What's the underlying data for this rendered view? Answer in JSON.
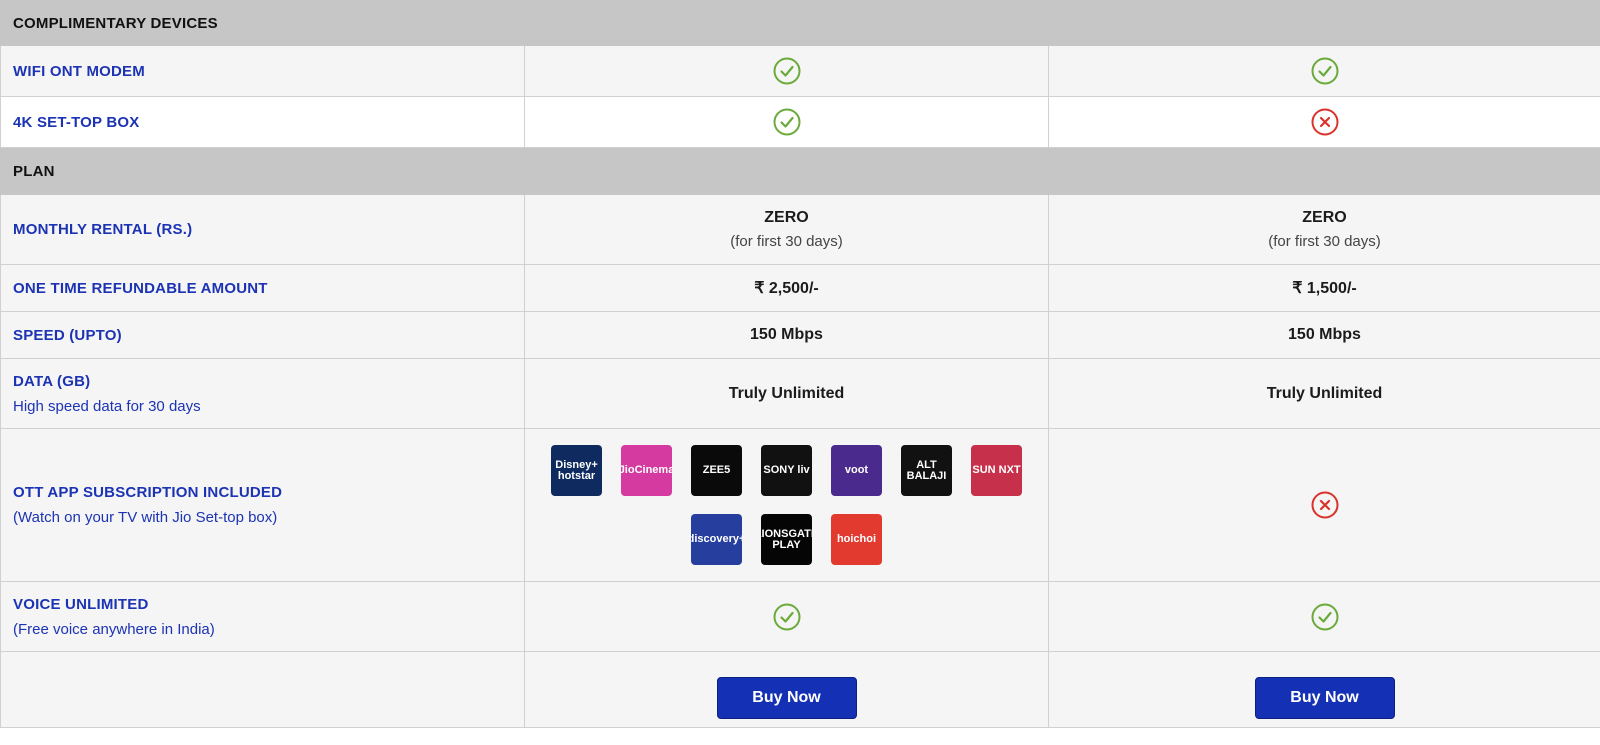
{
  "sections": {
    "devices": "COMPLIMENTARY DEVICES",
    "plan": "PLAN"
  },
  "rows": {
    "wifi": {
      "label": "WIFI ONT MODEM",
      "col1": "check",
      "col2": "check"
    },
    "stb": {
      "label": "4K SET-TOP BOX",
      "col1": "check",
      "col2": "cross"
    },
    "rental": {
      "label": "MONTHLY RENTAL (RS.)",
      "col1_main": "ZERO",
      "col1_sub": "(for first 30 days)",
      "col2_main": "ZERO",
      "col2_sub": "(for first 30 days)"
    },
    "refund": {
      "label": "ONE TIME REFUNDABLE AMOUNT",
      "col1": "₹ 2,500/-",
      "col2": "₹ 1,500/-"
    },
    "speed": {
      "label": "SPEED (UPTO)",
      "col1": "150 Mbps",
      "col2": "150 Mbps"
    },
    "data": {
      "label": "DATA (GB)",
      "sub": "High speed data for 30 days",
      "col1": "Truly Unlimited",
      "col2": "Truly Unlimited"
    },
    "ott": {
      "label": "OTT APP SUBSCRIPTION INCLUDED",
      "sub": "(Watch on your TV with Jio Set-top box)",
      "apps": [
        {
          "name": "disney-hotstar-logo",
          "text": "Disney+ hotstar",
          "color": "#0e2a5e"
        },
        {
          "name": "jiocinema-logo",
          "text": "JioCinema",
          "color": "#d43a9f"
        },
        {
          "name": "zee5-logo",
          "text": "ZEE5",
          "color": "#0a0a0a"
        },
        {
          "name": "sony-liv-logo",
          "text": "SONY liv",
          "color": "#111111"
        },
        {
          "name": "voot-logo",
          "text": "voot",
          "color": "#4a2a8c"
        },
        {
          "name": "alt-balaji-logo",
          "text": "ALT BALAJI",
          "color": "#111111"
        },
        {
          "name": "sun-nxt-logo",
          "text": "SUN NXT",
          "color": "#c7304a"
        },
        {
          "name": "discovery-plus-logo",
          "text": "discovery+",
          "color": "#263f9e"
        },
        {
          "name": "lionsgate-play-logo",
          "text": "LIONSGATE PLAY",
          "color": "#050505"
        },
        {
          "name": "hoichoi-logo",
          "text": "hoichoi",
          "color": "#e23a2e"
        }
      ],
      "col2": "cross"
    },
    "voice": {
      "label": "VOICE UNLIMITED",
      "sub": "(Free voice anywhere in India)",
      "col1": "check",
      "col2": "check"
    }
  },
  "buttons": {
    "col1": "Buy Now",
    "col2": "Buy Now"
  },
  "colors": {
    "check": "#6aaa3a",
    "cross": "#d9342b",
    "label": "#1c33b4",
    "button": "#1430b4",
    "header": "#c6c6c6"
  }
}
